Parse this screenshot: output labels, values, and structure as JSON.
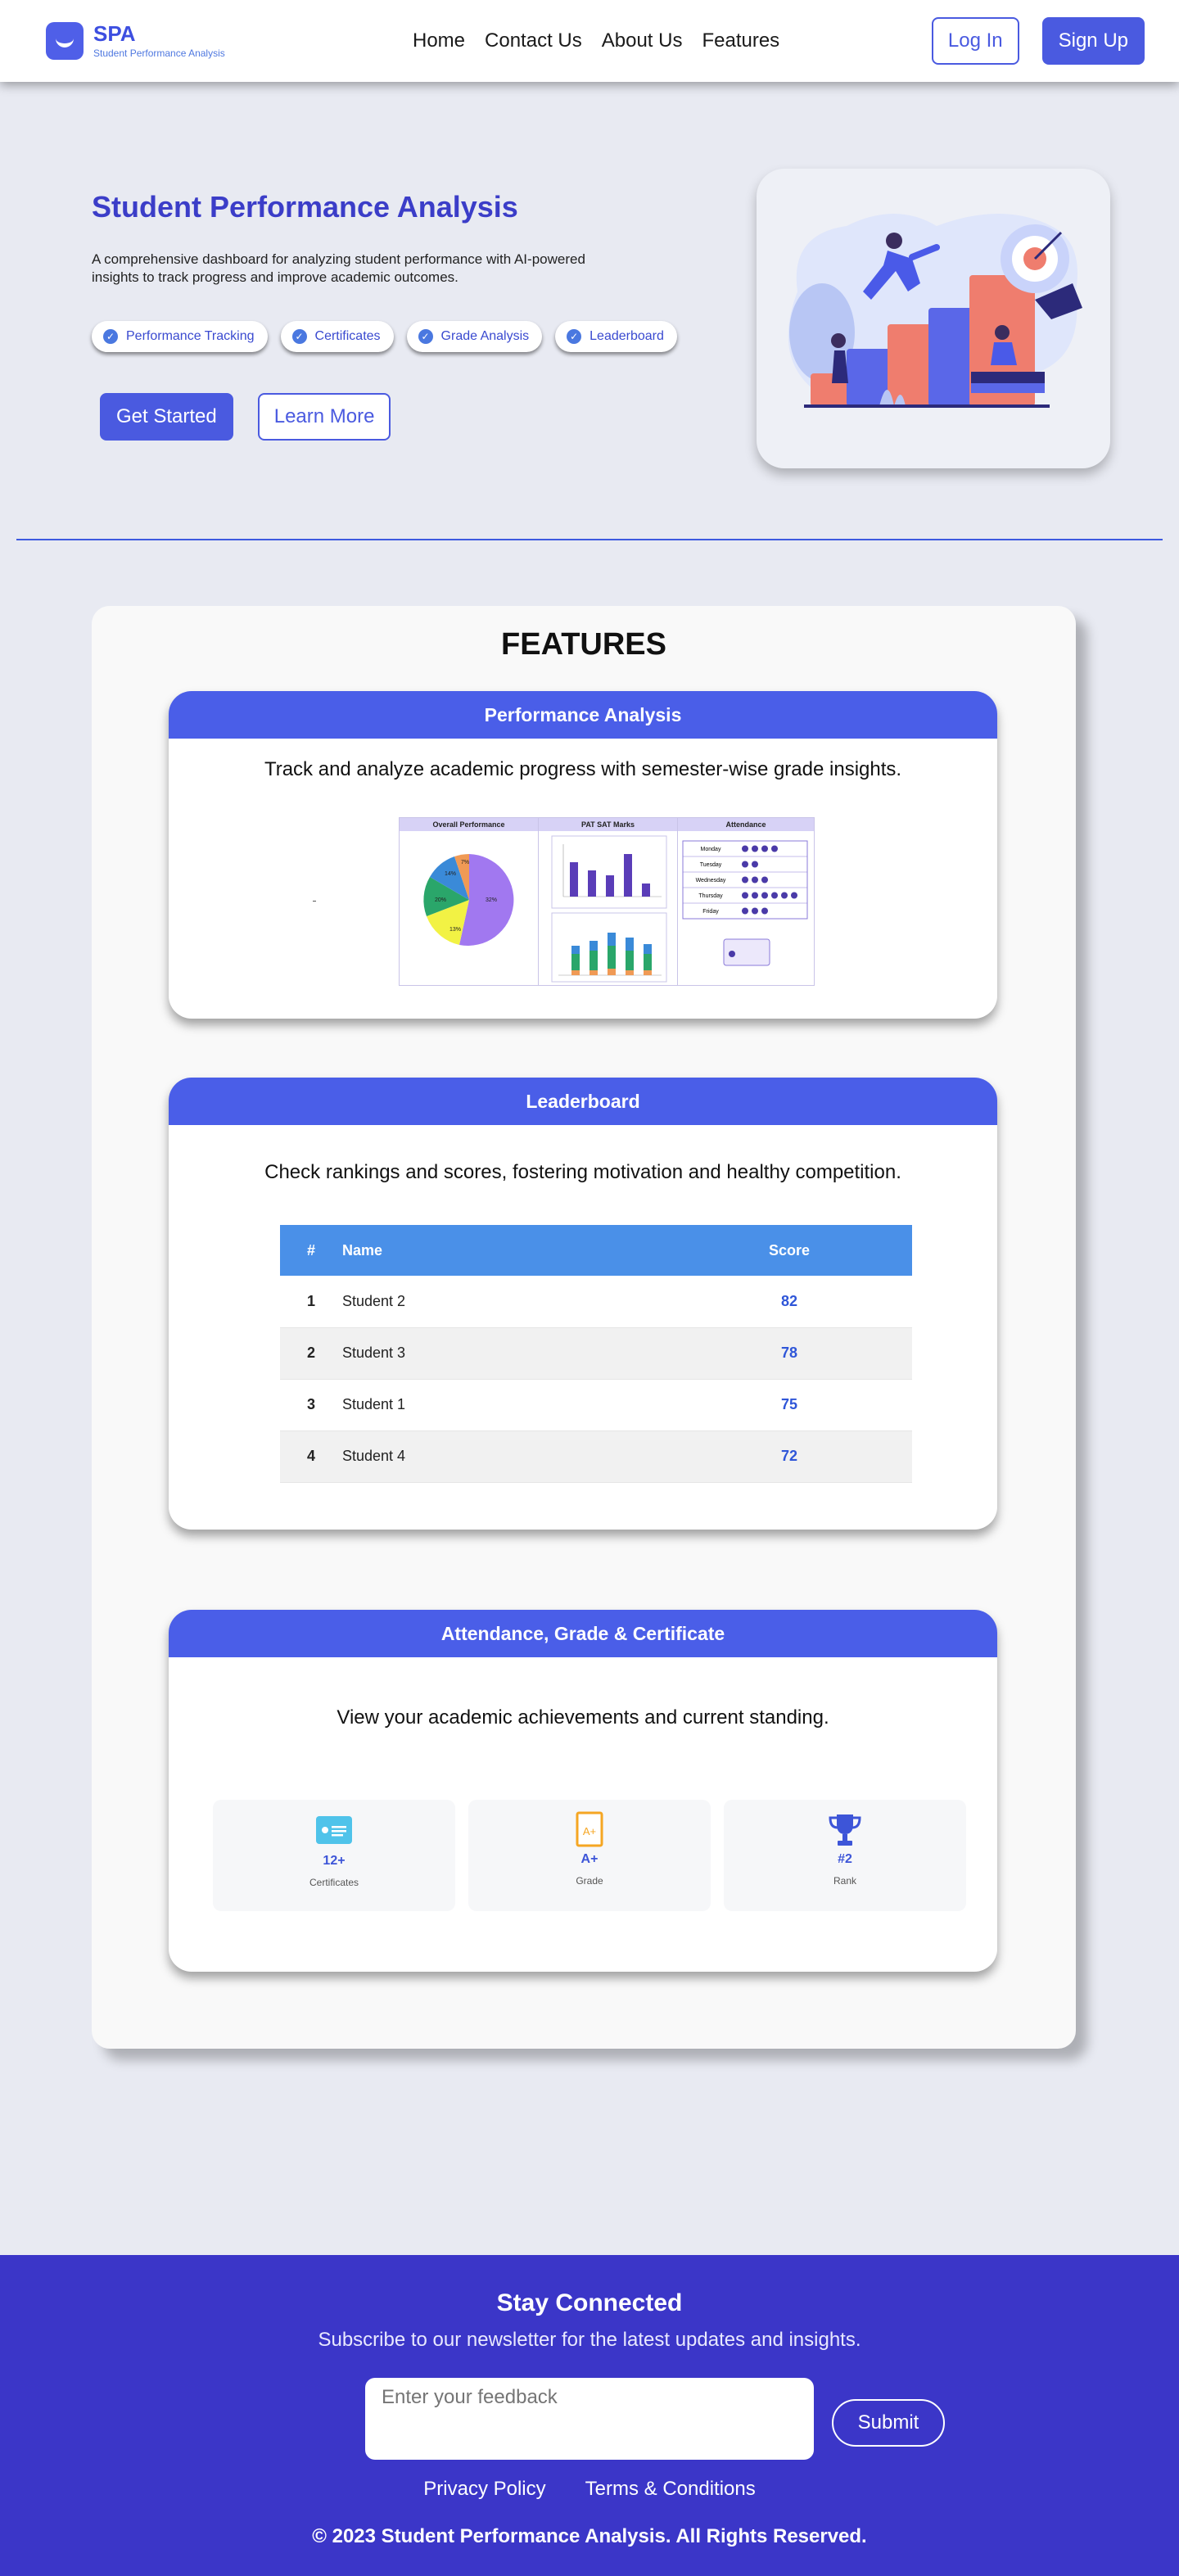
{
  "brand": {
    "name": "SPA",
    "subtitle": "Student Performance Analysis"
  },
  "nav": [
    "Home",
    "Contact Us",
    "About Us",
    "Features"
  ],
  "auth": {
    "login": "Log In",
    "signup": "Sign Up"
  },
  "hero": {
    "title": "Student Performance Analysis",
    "description": "A comprehensive dashboard for analyzing student performance with AI-powered insights to track progress and improve academic outcomes.",
    "chips": [
      "Performance Tracking",
      "Certificates",
      "Grade Analysis",
      "Leaderboard"
    ],
    "primary_button": "Get Started",
    "secondary_button": "Learn More"
  },
  "features": {
    "title": "FEATURES",
    "performance": {
      "title": "Performance Analysis",
      "description": "Track and analyze academic progress with semester-wise grade insights.",
      "dashboard": {
        "col1": "Overall Performance",
        "col2": "PAT SAT Marks",
        "col3": "Attendance",
        "pie_labels": [
          "32%",
          "13%",
          "20%",
          "14%",
          "7%"
        ],
        "days": [
          "Monday",
          "Tuesday",
          "Wednesday",
          "Thursday",
          "Friday"
        ],
        "day_counts": [
          4,
          2,
          3,
          6,
          3
        ]
      }
    },
    "leaderboard": {
      "title": "Leaderboard",
      "description": "Check rankings and scores, fostering motivation and healthy competition.",
      "columns": [
        "#",
        "Name",
        "Score"
      ],
      "rows": [
        {
          "rank": "1",
          "name": "Student 2",
          "score": "82"
        },
        {
          "rank": "2",
          "name": "Student 3",
          "score": "78"
        },
        {
          "rank": "3",
          "name": "Student 1",
          "score": "75"
        },
        {
          "rank": "4",
          "name": "Student 4",
          "score": "72"
        }
      ]
    },
    "achievements": {
      "title": "Attendance, Grade & Certificate",
      "description": "View your academic achievements and current standing.",
      "stats": [
        {
          "icon": "certificate-icon",
          "value": "12+",
          "label": "Certificates",
          "color": "#4fc3ea"
        },
        {
          "icon": "grade-icon",
          "value": "A+",
          "label": "Grade",
          "color": "#f5a623"
        },
        {
          "icon": "trophy-icon",
          "value": "#2",
          "label": "Rank",
          "color": "#3d55d8"
        }
      ]
    }
  },
  "footer": {
    "title": "Stay Connected",
    "subtitle": "Subscribe to our newsletter for the latest updates and insights.",
    "input_placeholder": "Enter your feedback",
    "submit": "Submit",
    "links": [
      "Privacy Policy",
      "Terms & Conditions"
    ],
    "copyright": "© 2023 Student Performance Analysis. All Rights Reserved."
  }
}
